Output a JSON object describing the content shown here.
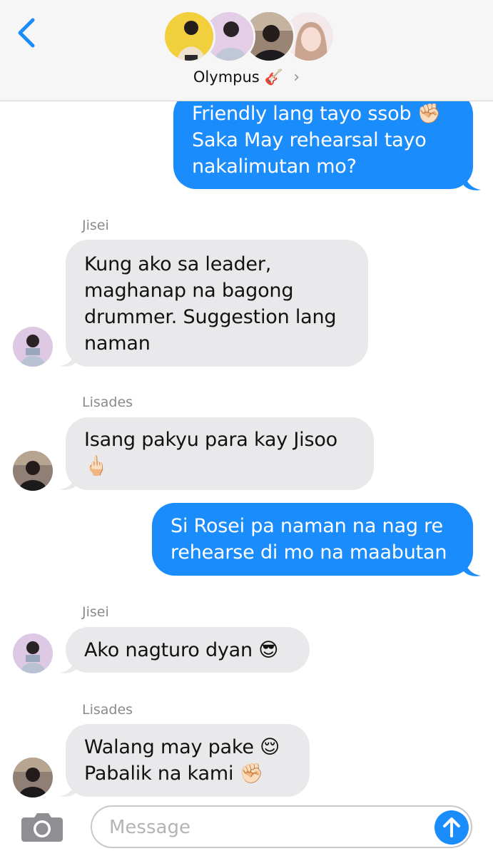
{
  "header": {
    "group_name": "Olympus",
    "group_emoji": "🎸",
    "chevron": "›",
    "icons": [
      "back-chevron-icon",
      "chevron-right-icon"
    ],
    "avatars": [
      "member-avatar-1",
      "member-avatar-2",
      "member-avatar-3",
      "member-avatar-4"
    ]
  },
  "messages": [
    {
      "type": "outgoing",
      "text": "Friendly lang tayo ssob ✊🏻\nSaka May rehearsal tayo\nnakalimutan mo?"
    },
    {
      "type": "incoming",
      "sender": "Jisei",
      "text": "Kung ako sa leader,\nmaghanap na bagong\ndrummer. Suggestion lang\nnaman"
    },
    {
      "type": "incoming",
      "sender": "Lisades",
      "text": "Isang pakyu para kay Jisoo\n🖕🏻"
    },
    {
      "type": "outgoing",
      "text": "Si Rosei pa naman na nag re\nrehearse di mo na maabutan"
    },
    {
      "type": "incoming",
      "sender": "Jisei",
      "text": "Ako nagturo dyan 😎"
    },
    {
      "type": "incoming",
      "sender": "Lisades",
      "text": "Walang may pake 😌\nPabalik na kami ✊🏻"
    }
  ],
  "composer": {
    "placeholder": "Message",
    "value": "",
    "icons": [
      "camera-icon",
      "send-arrow-icon"
    ]
  },
  "colors": {
    "accent": "#1b8cfb",
    "incoming_bubble": "#e9e9eb",
    "header_bg": "#f6f6f7",
    "sender_label": "#8a8a8e"
  }
}
